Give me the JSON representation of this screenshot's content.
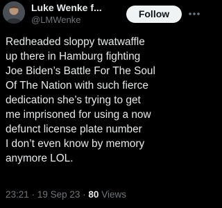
{
  "author": {
    "display_name": "Luke Wenke f...",
    "handle": "@LMWenke"
  },
  "actions": {
    "follow_label": "Follow"
  },
  "tweet": {
    "lines": [
      "Redheaded sloppy twatwaffle",
      "up there in Hamburg fighting",
      "Joe Biden’s Battle For The Soul",
      "Of The Nation with such fierce",
      "dedication she’s trying to get",
      "me imprisoned for using a now",
      "defunct license plate number",
      "I don’t even know by memory",
      "anymore LOL."
    ]
  },
  "meta": {
    "time": "23:21",
    "separator": "·",
    "date": "19 Sep 23",
    "views_count": "80",
    "views_label": "Views"
  },
  "colors": {
    "background": "#000000",
    "text_primary": "#e7e9ea",
    "text_secondary": "#71767b",
    "follow_button_bg": "#eff3f4",
    "follow_button_text": "#0f1419"
  },
  "icons": {
    "more": "more-horizontal-icon"
  }
}
